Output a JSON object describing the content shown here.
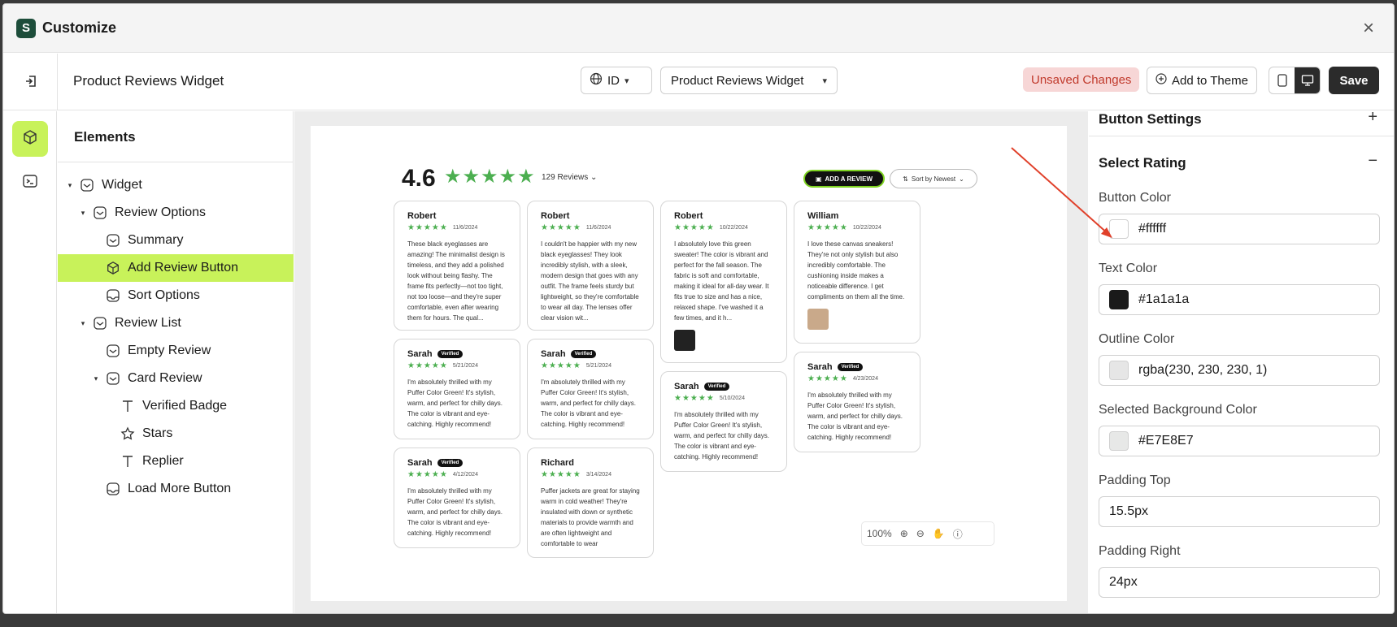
{
  "window": {
    "title": "Customize",
    "close_glyph": "×",
    "logo_letter": "S"
  },
  "toolbar": {
    "page_name": "Product Reviews Widget",
    "language": "ID",
    "widget_select": "Product Reviews Widget",
    "unsaved": "Unsaved Changes",
    "add_to_theme": "Add to Theme",
    "save": "Save"
  },
  "tree": {
    "title": "Elements",
    "items": [
      {
        "label": "Widget"
      },
      {
        "label": "Review Options"
      },
      {
        "label": "Summary"
      },
      {
        "label": "Add Review Button"
      },
      {
        "label": "Sort Options"
      },
      {
        "label": "Review List"
      },
      {
        "label": "Empty Review"
      },
      {
        "label": "Card Review"
      },
      {
        "label": "Verified Badge"
      },
      {
        "label": "Stars"
      },
      {
        "label": "Replier"
      },
      {
        "label": "Load More Button"
      }
    ]
  },
  "preview": {
    "rating": "4.6",
    "stars": "★★★★★",
    "reviews_count": "129 Reviews ⌄",
    "add_review": "ADD A REVIEW",
    "sort": "Sort by Newest",
    "cards": [
      {
        "name": "Robert",
        "verified": "",
        "stars": "★★★★★",
        "date": "11/6/2024",
        "body": "These black eyeglasses are amazing! The minimalist design is timeless, and they add a polished look without being flashy. The frame fits perfectly—not too tight, not too loose—and they're super comfortable, even after wearing them for hours. The qual..."
      },
      {
        "name": "Robert",
        "verified": "",
        "stars": "★★★★★",
        "date": "11/6/2024",
        "body": "I couldn't be happier with my new black eyeglasses! They look incredibly stylish, with a sleek, modern design that goes with any outfit. The frame feels sturdy but lightweight, so they're comfortable to wear all day. The lenses offer clear vision wit..."
      },
      {
        "name": "Robert",
        "verified": "",
        "stars": "★★★★★",
        "date": "10/22/2024",
        "body": "I absolutely love this green sweater! The color is vibrant and perfect for the fall season. The fabric is soft and comfortable, making it ideal for all-day wear. It fits true to size and has a nice, relaxed shape. I've washed it a few times, and it h..."
      },
      {
        "name": "William",
        "verified": "",
        "stars": "★★★★★",
        "date": "10/22/2024",
        "body": "I love these canvas sneakers! They're not only stylish but also incredibly comfortable. The cushioning inside makes a noticeable difference. I get compliments on them all the time."
      },
      {
        "name": "Sarah",
        "verified": "Verified",
        "stars": "★★★★★",
        "date": "5/21/2024",
        "body": "I'm absolutely thrilled with my Puffer Color Green! It's stylish, warm, and perfect for chilly days. The color is vibrant and eye-catching. Highly recommend!"
      },
      {
        "name": "Sarah",
        "verified": "Verified",
        "stars": "★★★★★",
        "date": "5/21/2024",
        "body": "I'm absolutely thrilled with my Puffer Color Green! It's stylish, warm, and perfect for chilly days. The color is vibrant and eye-catching. Highly recommend!"
      },
      {
        "name": "Sarah",
        "verified": "Verified",
        "stars": "★★★★★",
        "date": "5/10/2024",
        "body": "I'm absolutely thrilled with my Puffer Color Green! It's stylish, warm, and perfect for chilly days. The color is vibrant and eye-catching. Highly recommend!"
      },
      {
        "name": "Sarah",
        "verified": "Verified",
        "stars": "★★★★★",
        "date": "4/23/2024",
        "body": "I'm absolutely thrilled with my Puffer Color Green! It's stylish, warm, and perfect for chilly days. The color is vibrant and eye-catching. Highly recommend!"
      },
      {
        "name": "Sarah",
        "verified": "Verified",
        "stars": "★★★★★",
        "date": "4/12/2024",
        "body": "I'm absolutely thrilled with my Puffer Color Green! It's stylish, warm, and perfect for chilly days. The color is vibrant and eye-catching. Highly recommend!"
      },
      {
        "name": "Richard",
        "verified": "",
        "stars": "★★★★★",
        "date": "3/14/2024",
        "body": "Puffer jackets are great for staying warm in cold weather! They're insulated with down or synthetic materials to provide warmth and are often lightweight and comfortable to wear"
      }
    ],
    "zoom": "100%"
  },
  "settings": {
    "button_settings": "Button Settings",
    "select_rating": "Select Rating",
    "plus": "+",
    "minus": "−",
    "fields": [
      {
        "label": "Button Color",
        "value": "#ffffff",
        "swatch": "#ffffff"
      },
      {
        "label": "Text Color",
        "value": "#1a1a1a",
        "swatch": "#1a1a1a"
      },
      {
        "label": "Outline Color",
        "value": "rgba(230, 230, 230, 1)",
        "swatch": "#e6e6e6"
      },
      {
        "label": "Selected Background Color",
        "value": "#E7E8E7",
        "swatch": "#e7e8e7"
      },
      {
        "label": "Padding Top",
        "value": "15.5px"
      },
      {
        "label": "Padding Right",
        "value": "24px"
      }
    ]
  },
  "colors": {
    "accent": "#c8f25a",
    "star": "#4caf50",
    "unsaved_bg": "#f7d6d6",
    "unsaved_text": "#c0392b",
    "arrow": "#e0402a"
  }
}
